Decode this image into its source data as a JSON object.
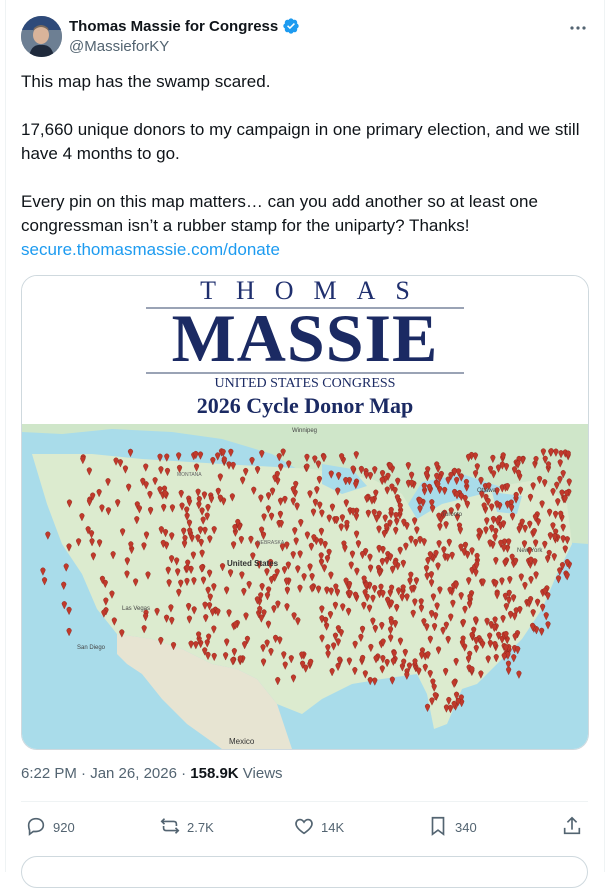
{
  "author": {
    "display_name": "Thomas Massie for Congress",
    "handle": "@MassieforKY"
  },
  "tweet": {
    "line1": "This map has the swamp scared.",
    "line2": "17,660 unique donors to my campaign in one primary election, and we still have 4 months to go.",
    "line3": "Every pin on this map matters… can you add another so at least one congressman isn’t a rubber stamp for the uniparty? Thanks!",
    "link": "secure.thomasmassie.com/donate"
  },
  "media": {
    "header_top": "THOMAS",
    "header_name": "MASSIE",
    "header_sub": "UNITED STATES CONGRESS",
    "header_title": "2026 Cycle Donor Map",
    "map_labels": {
      "usa": "United States",
      "mexico": "Mexico",
      "ottawa": "Ottawa",
      "toronto": "Toronto",
      "new_york": "New York",
      "las_vegas": "Las Vegas",
      "san_diego": "San Diego",
      "montana": "MONTANA",
      "nebraska": "NEBRASKA",
      "winnipeg": "Winnipeg"
    }
  },
  "meta": {
    "time": "6:22 PM · Jan 26, 2026 · ",
    "views_count": "158.9K",
    "views_label": " Views"
  },
  "actions": {
    "replies": "920",
    "reposts": "2.7K",
    "likes": "14K",
    "bookmarks": "340"
  },
  "colors": {
    "accent": "#1d9bf0",
    "secondary_text": "#536471",
    "pin": "#c0392b",
    "massie_navy": "#1b2a63"
  }
}
